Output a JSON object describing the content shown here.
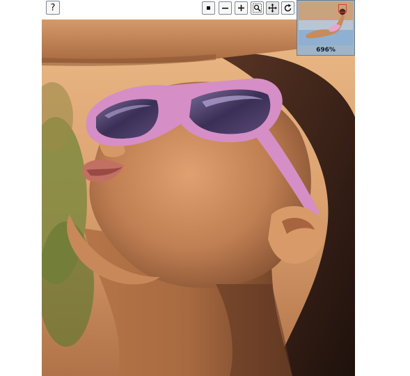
{
  "toolbar": {
    "help_label": "?",
    "buttons": [
      {
        "name": "stop-button",
        "icon": "stop-icon"
      },
      {
        "name": "zoom-out-button",
        "icon": "minus-icon"
      },
      {
        "name": "zoom-in-button",
        "icon": "plus-icon"
      },
      {
        "name": "zoom-fit-button",
        "icon": "magnifier-icon"
      },
      {
        "name": "pan-button",
        "icon": "move-arrows-icon"
      },
      {
        "name": "rotate-button",
        "icon": "rotate-icon"
      }
    ]
  },
  "navigator": {
    "zoom_text": "696%",
    "frame_color": "#e23a2a"
  },
  "colors": {
    "skin": "#c98a5c",
    "sunglasses": "#d58bc4",
    "hair": "#3a2018",
    "background_warm": "#e2ad78",
    "foliage": "#7a8a3e"
  }
}
